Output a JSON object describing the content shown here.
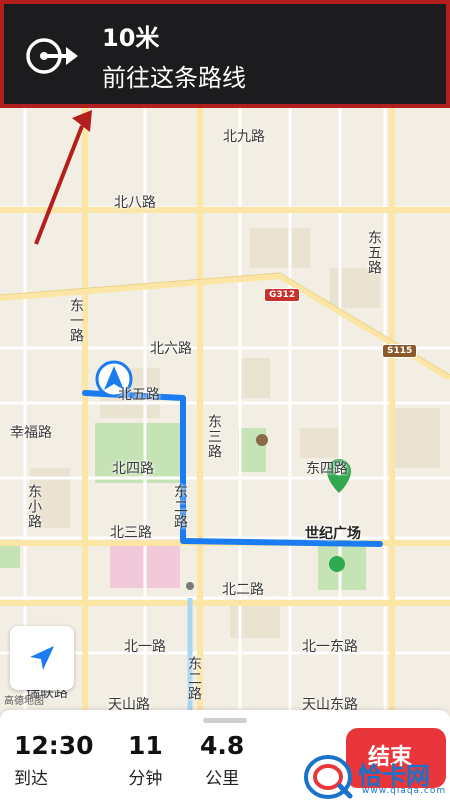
{
  "banner": {
    "distance": "10米",
    "instruction": "前往这条路线",
    "turn_icon": "turn-right-icon"
  },
  "map": {
    "roads": {
      "bei_jiu": "北九路",
      "bei_ba": "北八路",
      "dong_wu": "东五路",
      "dong_yi": "东一路",
      "bei_liu": "北六路",
      "bei_wu": "北五路",
      "xing_fu": "幸福路",
      "dong_san": "东三路",
      "bei_si": "北四路",
      "dong_si": "东四路",
      "dong_xiao": "东小路",
      "dong_er": "东二路",
      "bei_san": "北三路",
      "bei_er": "北二路",
      "bei_yi": "北一路",
      "bei_yi_dong": "北一东路",
      "dong_er_b": "东二路",
      "tian_shan": "天山路",
      "tian_shan_dong": "天山东路",
      "rui_lian": "瑞联路"
    },
    "shields": {
      "g312": "G312",
      "s115": "S115"
    },
    "poi": "世纪广场",
    "watermark": "高德地图",
    "colors": {
      "route": "#1a7cf0",
      "poi": "#2fa84f",
      "park": "#c6e3b5"
    }
  },
  "trip": {
    "arrive_time": "12:30",
    "arrive_label": "到达",
    "minutes": "11",
    "minutes_label": "分钟",
    "distance_km": "4.8",
    "distance_label": "公里",
    "end_button": "结束"
  },
  "brand": {
    "name": "恰卡网",
    "url": "www.qiaqa.com"
  }
}
